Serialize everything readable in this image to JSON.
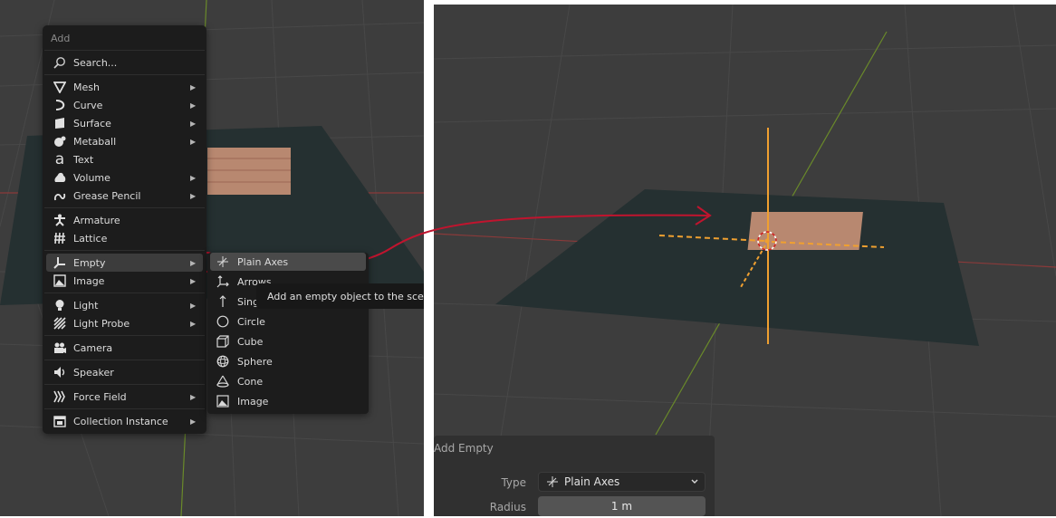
{
  "menu": {
    "title": "Add",
    "search": "Search...",
    "items": [
      {
        "label": "Mesh",
        "icon": "mesh-cone-icon",
        "submenu": true
      },
      {
        "label": "Curve",
        "icon": "curve-icon",
        "submenu": true
      },
      {
        "label": "Surface",
        "icon": "surface-icon",
        "submenu": true
      },
      {
        "label": "Metaball",
        "icon": "metaball-icon",
        "submenu": true
      },
      {
        "label": "Text",
        "icon": "text-icon",
        "submenu": false
      },
      {
        "label": "Volume",
        "icon": "volume-icon",
        "submenu": true
      },
      {
        "label": "Grease Pencil",
        "icon": "grease-pencil-icon",
        "submenu": true
      },
      {
        "label": "Armature",
        "icon": "armature-icon",
        "submenu": false
      },
      {
        "label": "Lattice",
        "icon": "lattice-icon",
        "submenu": false
      },
      {
        "label": "Empty",
        "icon": "empty-icon",
        "submenu": true
      },
      {
        "label": "Image",
        "icon": "image-icon",
        "submenu": true
      },
      {
        "label": "Light",
        "icon": "light-icon",
        "submenu": true
      },
      {
        "label": "Light Probe",
        "icon": "light-probe-icon",
        "submenu": true
      },
      {
        "label": "Camera",
        "icon": "camera-icon",
        "submenu": false
      },
      {
        "label": "Speaker",
        "icon": "speaker-icon",
        "submenu": false
      },
      {
        "label": "Force Field",
        "icon": "force-field-icon",
        "submenu": true
      },
      {
        "label": "Collection Instance",
        "icon": "collection-instance-icon",
        "submenu": true
      }
    ]
  },
  "empty_submenu": {
    "items": [
      {
        "label": "Plain Axes",
        "icon": "plain-axes-icon"
      },
      {
        "label": "Arrows",
        "icon": "arrows-icon"
      },
      {
        "label": "Single Arrow",
        "icon": "single-arrow-icon"
      },
      {
        "label": "Circle",
        "icon": "circle-icon"
      },
      {
        "label": "Cube",
        "icon": "cube-icon"
      },
      {
        "label": "Sphere",
        "icon": "sphere-icon"
      },
      {
        "label": "Cone",
        "icon": "cone-icon"
      },
      {
        "label": "Image",
        "icon": "image-icon"
      }
    ]
  },
  "tooltip": "Add an empty object to the scene",
  "redo_panel": {
    "title": "Add Empty",
    "type_label": "Type",
    "type_value": "Plain Axes",
    "radius_label": "Radius",
    "radius_value": "1 m"
  },
  "colors": {
    "viewport_bg": "#3d3d3d",
    "menu_bg": "#1c1c1c",
    "annotation_red": "#c0142e",
    "origin_orange": "#f0a030"
  }
}
